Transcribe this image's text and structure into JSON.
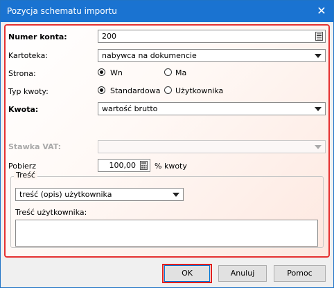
{
  "window": {
    "title": "Pozycja schematu importu",
    "close_glyph": "✕"
  },
  "form": {
    "numer_konta": {
      "label": "Numer konta:",
      "value": "200"
    },
    "kartoteka": {
      "label": "Kartoteka:",
      "value": "nabywca na dokumencie"
    },
    "strona": {
      "label": "Strona:",
      "options": [
        "Wn",
        "Ma"
      ],
      "selected": "Wn"
    },
    "typ_kwoty": {
      "label": "Typ kwoty:",
      "options": [
        "Standardowa",
        "Użytkownika"
      ],
      "selected": "Standardowa"
    },
    "kwota": {
      "label": "Kwota:",
      "value": "wartość brutto"
    },
    "stawka_vat": {
      "label": "Stawka VAT:",
      "value": ""
    },
    "pobierz": {
      "label": "Pobierz",
      "value": "100,00",
      "suffix": "% kwoty"
    },
    "tresc": {
      "legend": "Treść",
      "select_value": "treść (opis) użytkownika",
      "user_label": "Treść użytkownika:",
      "user_value": ""
    }
  },
  "buttons": {
    "ok": "OK",
    "cancel": "Anuluj",
    "help": "Pomoc"
  },
  "colors": {
    "title_bar": "#1a73d1",
    "highlight": "#e53030",
    "focus": "#0078d7"
  }
}
